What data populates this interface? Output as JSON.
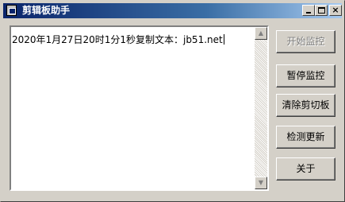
{
  "window": {
    "title": "剪辑板助手",
    "controls": {
      "minimize": "_",
      "maximize": "□",
      "close": "×"
    }
  },
  "editor": {
    "content": "2020年1月27日20时1分1秒复制文本：jb51.net",
    "scroll_up_glyph": "▲",
    "scroll_down_glyph": "▼"
  },
  "buttons": [
    {
      "label": "开始监控",
      "enabled": false
    },
    {
      "label": "暂停监控",
      "enabled": true
    },
    {
      "label": "清除剪切板",
      "enabled": true
    },
    {
      "label": "检测更新",
      "enabled": true
    },
    {
      "label": "关于",
      "enabled": true
    }
  ]
}
